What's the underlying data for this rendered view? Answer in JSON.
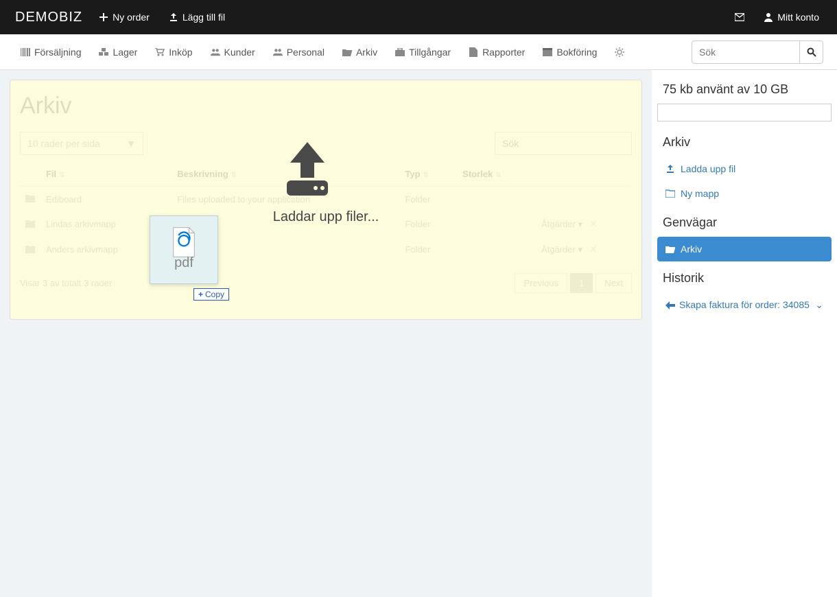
{
  "topbar": {
    "logo": "DEMOBIZ",
    "new_order": "Ny order",
    "add_file": "Lägg till fil",
    "my_account": "Mitt konto"
  },
  "nav": {
    "items": [
      "Försäljning",
      "Lager",
      "Inköp",
      "Kunder",
      "Personal",
      "Arkiv",
      "Tillgångar",
      "Rapporter",
      "Bokföring"
    ],
    "search_placeholder": "Sök"
  },
  "panel": {
    "title": "Arkiv",
    "rows_per_page": "10 rader per sida",
    "filter_placeholder": "Sök",
    "columns": {
      "file": "Fil",
      "desc": "Beskrivning",
      "type": "Typ",
      "size": "Storlek"
    },
    "rows": [
      {
        "name": "Ediboard",
        "desc": "Files uploaded to your application",
        "type": "Folder",
        "actions": ""
      },
      {
        "name": "Lindas arkivmapp",
        "desc": "",
        "type": "Folder",
        "actions": "Åtgärder"
      },
      {
        "name": "Anders arkivmapp",
        "desc": "",
        "type": "Folder",
        "actions": "Åtgärder"
      }
    ],
    "showing": "Visar 3 av totalt 3 rader",
    "prev": "Previous",
    "page": "1",
    "next": "Next"
  },
  "drop": {
    "uploading": "Laddar upp filer...",
    "copy_badge": "Copy",
    "pdf_label": "pdf"
  },
  "sidebar": {
    "storage": "75 kb använt av 10 GB",
    "arkiv_heading": "Arkiv",
    "upload_link": "Ladda upp fil",
    "new_folder": "Ny mapp",
    "shortcuts_heading": "Genvägar",
    "shortcut_arkiv": "Arkiv",
    "history_heading": "Historik",
    "history_item": "Skapa faktura för order: 34085"
  }
}
